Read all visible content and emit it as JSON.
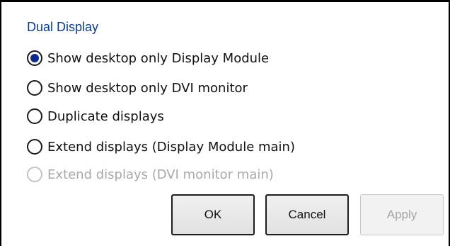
{
  "dialog": {
    "group_title": "Dual Display",
    "options": [
      {
        "label": "Show desktop only Display Module",
        "selected": true,
        "enabled": true
      },
      {
        "label": "Show desktop only DVI monitor",
        "selected": false,
        "enabled": true
      },
      {
        "label": "Duplicate displays",
        "selected": false,
        "enabled": true
      },
      {
        "label": "Extend displays (Display Module main)",
        "selected": false,
        "enabled": true
      },
      {
        "label": "Extend displays (DVI monitor main)",
        "selected": false,
        "enabled": false
      }
    ],
    "buttons": {
      "ok": "OK",
      "cancel": "Cancel",
      "apply": "Apply"
    },
    "colors": {
      "title": "#0a3c9c",
      "radio_dot": "#0d2a8f",
      "disabled_text": "#a8a8a8"
    }
  }
}
